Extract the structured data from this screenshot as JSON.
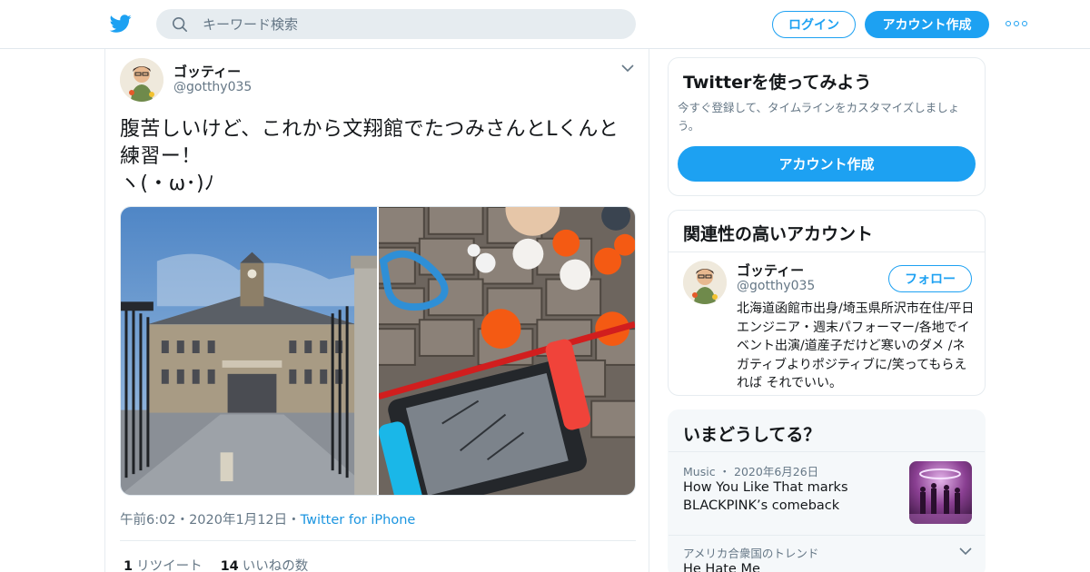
{
  "header": {
    "search_placeholder": "キーワード検索",
    "login_label": "ログイン",
    "signup_label": "アカウント作成"
  },
  "tweet": {
    "author_name": "ゴッティー",
    "author_handle": "@gotthy035",
    "text": "腹苦しいけど、これから文翔館でたつみさんとLくんと練習ー！\nヽ(・ω･)ﾉ",
    "time": "午前6:02",
    "date": "2020年1月12日",
    "source": "Twitter for iPhone",
    "retweet_count": "1",
    "retweet_label": "リツイート",
    "like_count": "14",
    "like_label": "いいねの数",
    "separator": "・"
  },
  "signup_card": {
    "title": "Twitterを使ってみよう",
    "description": "今すぐ登録して、タイムラインをカスタマイズしましょう。",
    "button_label": "アカウント作成"
  },
  "related": {
    "title": "関連性の高いアカウント",
    "account": {
      "name": "ゴッティー",
      "handle": "@gotthy035",
      "follow_label": "フォロー",
      "bio": "北海道函館市出身/埼玉県所沢市在住/平日エンジニア・週末パフォーマー/各地でイベント出演/道産子だけど寒いのダメ /ネガティブよりポジティブに/笑ってもらえれば それでいい。"
    }
  },
  "trends": {
    "title": "いまどうしてる？",
    "items": [
      {
        "context": "Music ・ 2020年6月26日",
        "headline": "How You Like That marks BLACKPINK’s comeback"
      },
      {
        "context": "アメリカ合衆国のトレンド",
        "headline": "He Hate Me"
      }
    ]
  },
  "colors": {
    "accent": "#1da1f2",
    "text": "#14171a",
    "secondary_text": "#657786",
    "border": "#e6ecf0"
  },
  "icons": [
    "twitter-bird-icon",
    "search-icon",
    "more-dots-icon",
    "chevron-down-icon"
  ]
}
